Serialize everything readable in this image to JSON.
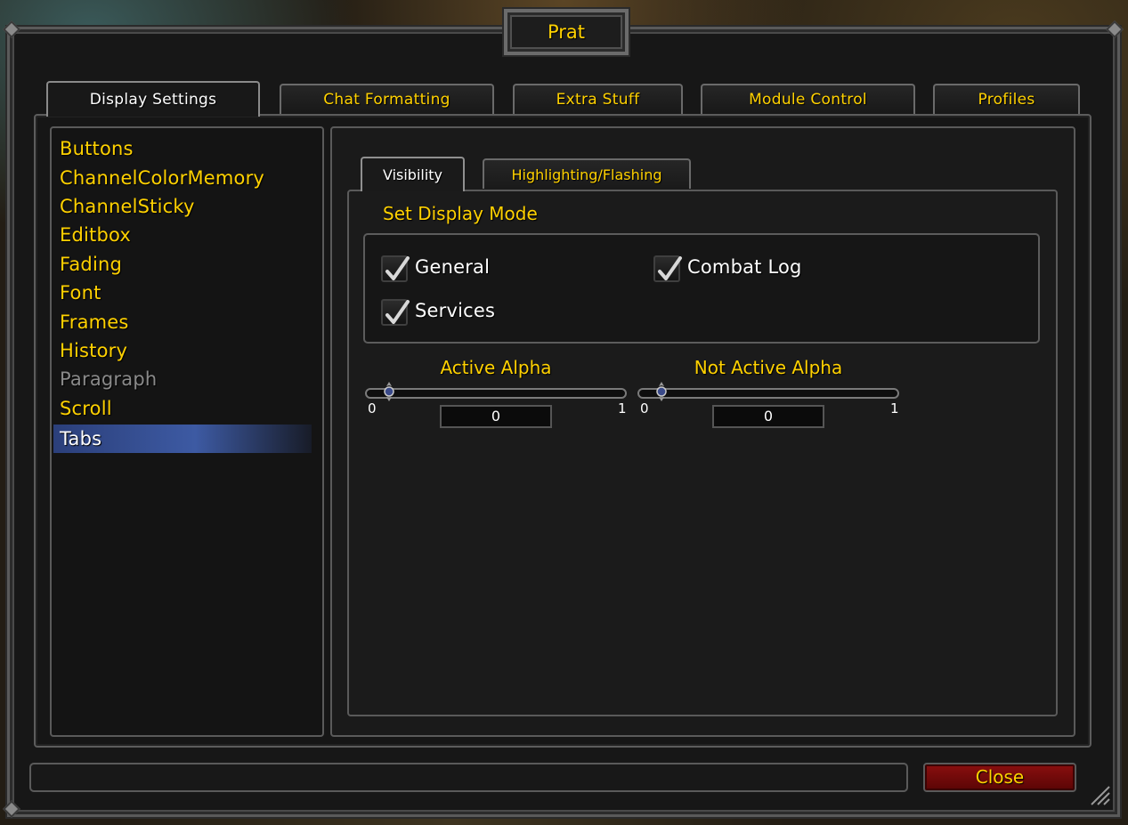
{
  "window": {
    "title": "Prat"
  },
  "top_tabs": [
    {
      "label": "Display Settings",
      "active": true
    },
    {
      "label": "Chat Formatting",
      "active": false
    },
    {
      "label": "Extra Stuff",
      "active": false
    },
    {
      "label": "Module Control",
      "active": false
    },
    {
      "label": "Profiles",
      "active": false
    }
  ],
  "module_list": [
    {
      "label": "Buttons",
      "state": "normal"
    },
    {
      "label": "ChannelColorMemory",
      "state": "normal"
    },
    {
      "label": "ChannelSticky",
      "state": "normal"
    },
    {
      "label": "Editbox",
      "state": "normal"
    },
    {
      "label": "Fading",
      "state": "normal"
    },
    {
      "label": "Font",
      "state": "normal"
    },
    {
      "label": "Frames",
      "state": "normal"
    },
    {
      "label": "History",
      "state": "normal"
    },
    {
      "label": "Paragraph",
      "state": "disabled"
    },
    {
      "label": "Scroll",
      "state": "normal"
    },
    {
      "label": "Tabs",
      "state": "selected"
    }
  ],
  "sub_tabs": [
    {
      "label": "Visibility",
      "active": true
    },
    {
      "label": "Highlighting/Flashing",
      "active": false
    }
  ],
  "display_mode": {
    "title": "Set Display Mode",
    "options": [
      {
        "label": "General",
        "checked": true
      },
      {
        "label": "Combat Log",
        "checked": true
      },
      {
        "label": "Services",
        "checked": true
      }
    ]
  },
  "sliders": [
    {
      "label": "Active Alpha",
      "min": "0",
      "max": "1",
      "value": "0",
      "fraction": 0
    },
    {
      "label": "Not Active Alpha",
      "min": "0",
      "max": "1",
      "value": "0",
      "fraction": 0
    }
  ],
  "footer": {
    "status_text": "",
    "close_label": "Close"
  },
  "colors": {
    "gold": "#ffd100",
    "white": "#ffffff",
    "disabled": "#8a8a8a",
    "selection": "#3d5aa3",
    "close_button": "#8a0f0f"
  }
}
